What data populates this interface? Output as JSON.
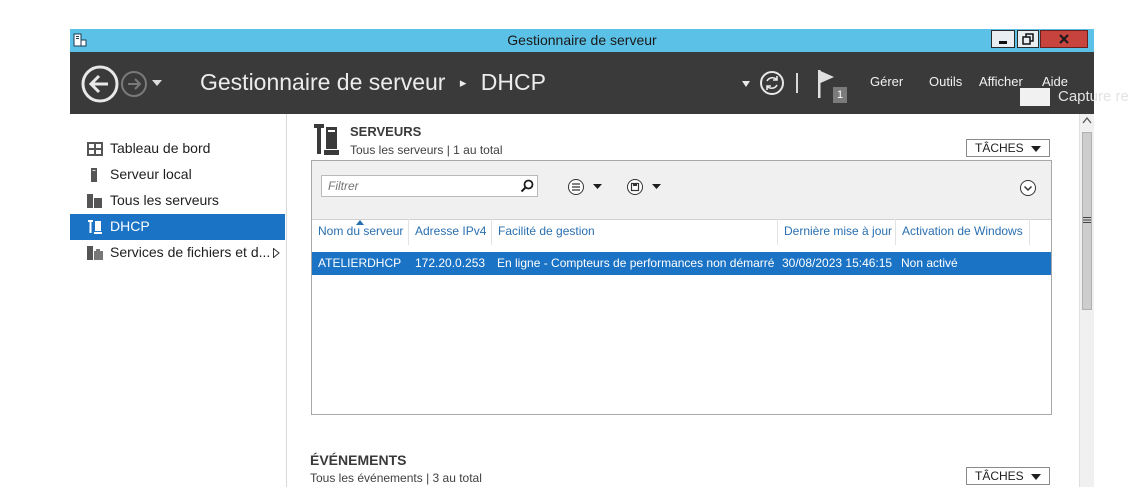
{
  "window": {
    "title": "Gestionnaire de serveur"
  },
  "header": {
    "breadcrumb_root": "Gestionnaire de serveur",
    "breadcrumb_sep": "▸",
    "breadcrumb_current": "DHCP",
    "notification_count": "1",
    "menu": [
      "Gérer",
      "Outils",
      "Afficher",
      "Aide"
    ]
  },
  "sidebar": {
    "items": [
      {
        "label": "Tableau de bord",
        "icon": "dashboard-icon",
        "selected": false
      },
      {
        "label": "Serveur local",
        "icon": "local-server-icon",
        "selected": false
      },
      {
        "label": "Tous les serveurs",
        "icon": "all-servers-icon",
        "selected": false
      },
      {
        "label": "DHCP",
        "icon": "dhcp-icon",
        "selected": true
      },
      {
        "label": "Services de fichiers et d...",
        "icon": "file-services-icon",
        "selected": false,
        "has_submenu": true
      }
    ]
  },
  "servers": {
    "title": "SERVEURS",
    "subtitle": "Tous les serveurs | 1 au total",
    "tasks_label": "TÂCHES",
    "filter_placeholder": "Filtrer",
    "columns": [
      "Nom du serveur",
      "Adresse IPv4",
      "Facilité de gestion",
      "Dernière mise à jour",
      "Activation de Windows"
    ],
    "sorted_column": "Nom du serveur",
    "rows": [
      [
        "ATELIERDHCP",
        "172.20.0.253",
        "En ligne - Compteurs de performances non démarré",
        "30/08/2023 15:46:15",
        "Non activé"
      ]
    ]
  },
  "events": {
    "title": "ÉVÉNEMENTS",
    "subtitle": "Tous les événements | 3 au total",
    "tasks_label": "TÂCHES"
  },
  "overlay": {
    "ghost_text": "Capture re"
  },
  "colors": {
    "titlebar": "#5bc1e6",
    "topbar": "#3a3a3a",
    "selection": "#1a73c5",
    "link_header": "#2a6fb0"
  }
}
